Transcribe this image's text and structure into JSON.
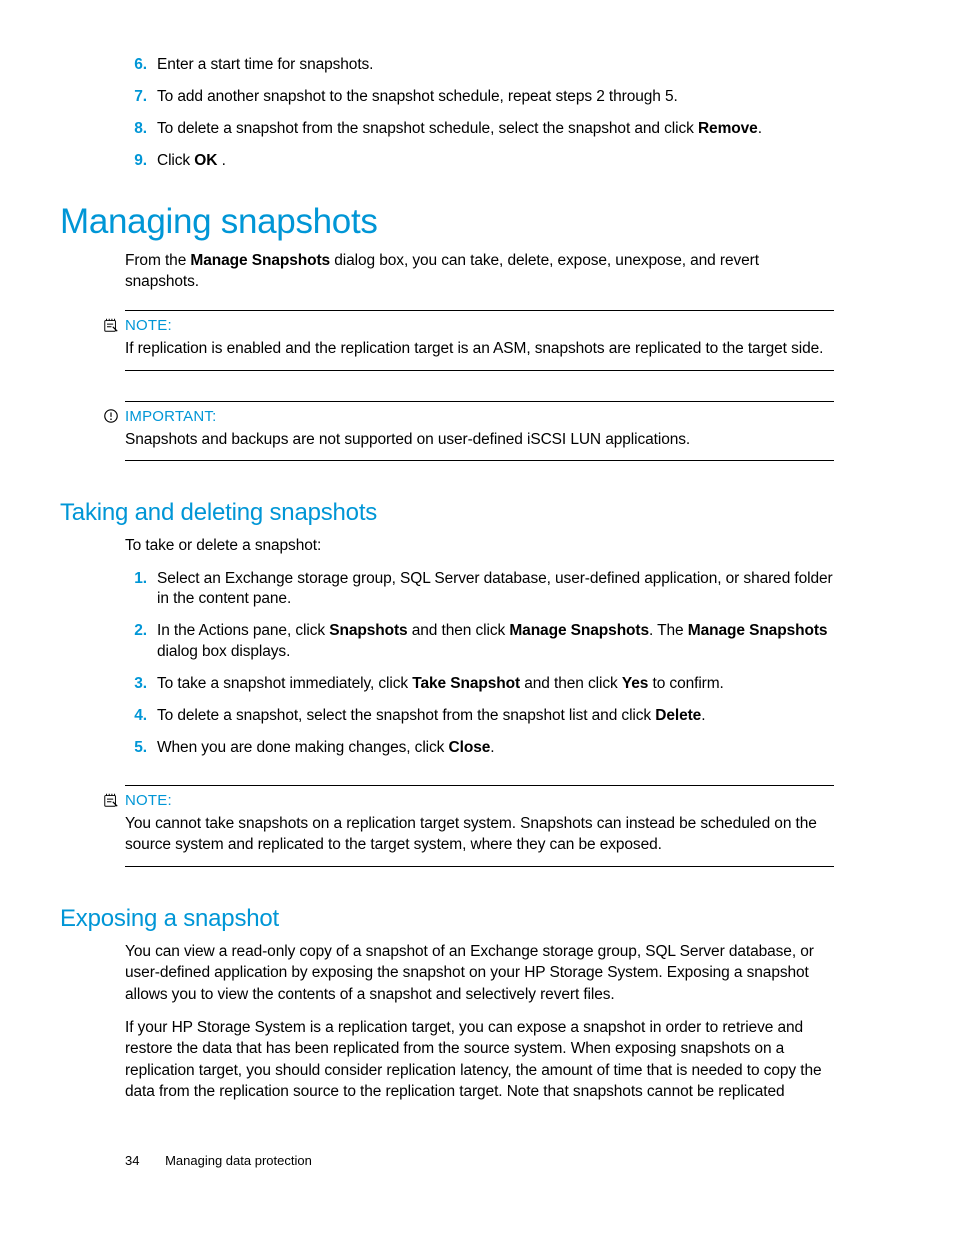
{
  "topSteps": [
    {
      "n": "6.",
      "text": "Enter a start time for snapshots."
    },
    {
      "n": "7.",
      "text": "To add another snapshot to the snapshot schedule, repeat steps 2 through 5."
    },
    {
      "n": "8.",
      "pre": "To delete a snapshot from the snapshot schedule, select the snapshot and click ",
      "b1": "Remove",
      "post": "."
    },
    {
      "n": "9.",
      "pre": "Click ",
      "b1": "OK",
      "post": " ."
    }
  ],
  "h1": "Managing snapshots",
  "intro": {
    "pre": "From the ",
    "b1": "Manage Snapshots",
    "post": " dialog box, you can take, delete, expose, unexpose, and revert snapshots."
  },
  "note1": {
    "label": "NOTE:",
    "text": "If replication is enabled and the replication target is an ASM, snapshots are replicated to the target side."
  },
  "important": {
    "label": "IMPORTANT:",
    "text": "Snapshots and backups are not supported on user-defined iSCSI LUN applications."
  },
  "h2a": "Taking and deleting snapshots",
  "lead_a": "To take or delete a snapshot:",
  "stepsA": [
    {
      "n": "1.",
      "text": "Select an Exchange storage group, SQL Server database, user-defined application, or shared folder in the content pane."
    },
    {
      "n": "2.",
      "pre": "In the Actions pane, click ",
      "b1": "Snapshots",
      "mid1": " and then click ",
      "b2": "Manage Snapshots",
      "mid2": ". The ",
      "b3": "Manage Snapshots",
      "post": " dialog box displays."
    },
    {
      "n": "3.",
      "pre": "To take a snapshot immediately, click ",
      "b1": "Take Snapshot",
      "mid1": " and then click ",
      "b2": "Yes",
      "post": " to confirm."
    },
    {
      "n": "4.",
      "pre": "To delete a snapshot, select the snapshot from the snapshot list and click ",
      "b1": "Delete",
      "post": "."
    },
    {
      "n": "5.",
      "pre": "When you are done making changes, click ",
      "b1": "Close",
      "post": "."
    }
  ],
  "note2": {
    "label": "NOTE:",
    "text": "You cannot take snapshots on a replication target system. Snapshots can instead be scheduled on the source system and replicated to the target system, where they can be exposed."
  },
  "h2b": "Exposing a snapshot",
  "para_b1": "You can view a read-only copy of a snapshot of an Exchange storage group, SQL Server database, or user-defined application by exposing the snapshot on your HP Storage System. Exposing a snapshot allows you to view the contents of a snapshot and selectively revert files.",
  "para_b2": "If your HP Storage System is a replication target, you can expose a snapshot in order to retrieve and restore the data that has been replicated from the source system. When exposing snapshots on a replication target, you should consider replication latency, the amount of time that is needed to copy the data from the replication source to the replication target. Note that snapshots cannot be replicated",
  "footer": {
    "page": "34",
    "title": "Managing data protection"
  }
}
